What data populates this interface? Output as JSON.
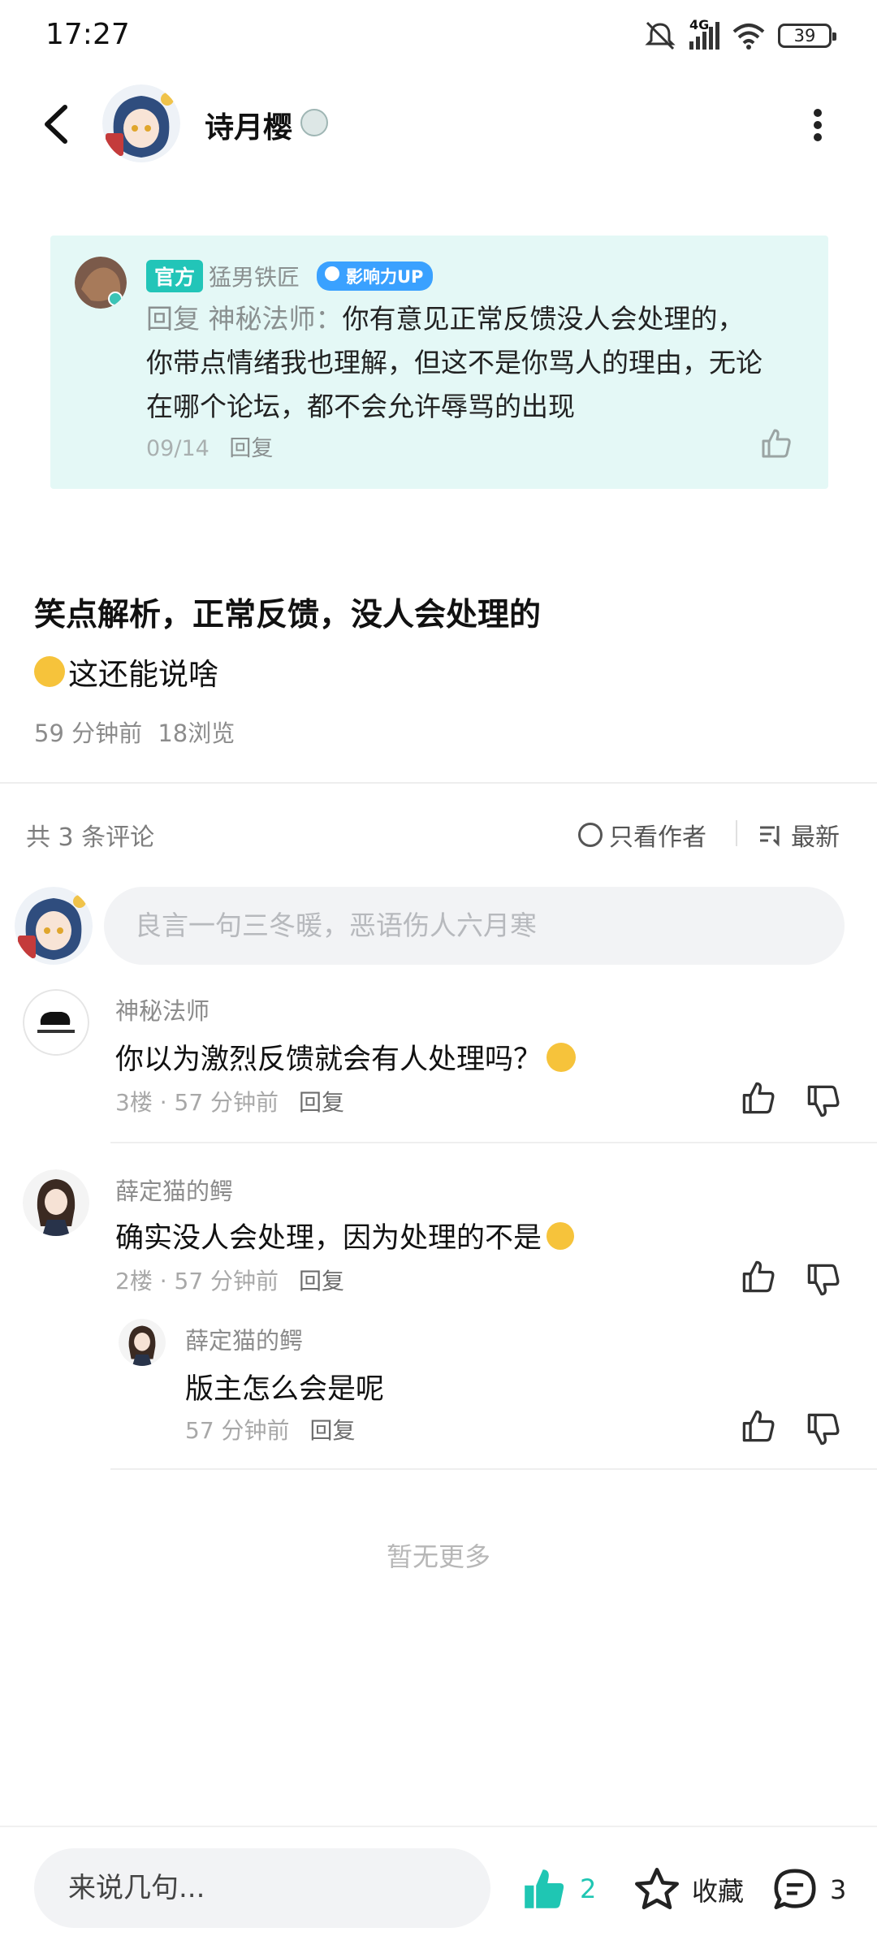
{
  "status_bar": {
    "time": "17:27",
    "network": "4G",
    "battery": "39"
  },
  "header": {
    "author_name": "诗月樱"
  },
  "quote_card": {
    "tag": "官方",
    "user_name": "猛男铁匠",
    "badge": "影响力UP",
    "reply_prefix": "回复 神秘法师：",
    "text_line1": "你有意见正常反馈没人会处理的，",
    "text_line2": "你带点情绪我也理解，但这不是你骂人的理由，无论",
    "text_line3": "在哪个论坛，都不会允许辱骂的出现",
    "date": "09/14",
    "reply_label": "回复"
  },
  "post": {
    "title": "笑点解析，正常反馈，没人会处理的",
    "body": "这还能说啥",
    "time": "59 分钟前",
    "views": "18浏览"
  },
  "comments_bar": {
    "count": "共 3 条评论",
    "author_only": "只看作者",
    "sort": "最新"
  },
  "comment_input": {
    "placeholder": "良言一句三冬暖，恶语伤人六月寒"
  },
  "comments": [
    {
      "name": "神秘法师",
      "text": "你以为激烈反馈就会有人处理吗？",
      "floor": "3楼",
      "time": "57 分钟前",
      "reply_label": "回复"
    },
    {
      "name": "薛定猫的鳄",
      "text": "确实没人会处理，因为处理的不是",
      "floor": "2楼",
      "time": "57 分钟前",
      "reply_label": "回复",
      "replies": [
        {
          "name": "薛定猫的鳄",
          "text": "版主怎么会是呢",
          "time": "57 分钟前",
          "reply_label": "回复"
        }
      ]
    }
  ],
  "no_more": "暂无更多",
  "bottom_bar": {
    "input_placeholder": "来说几句...",
    "like_count": "2",
    "favorite_label": "收藏",
    "comment_count": "3"
  },
  "colors": {
    "accent": "#1fc6b3",
    "quote_bg": "#e4f8f6",
    "official_tag": "#22c5b8",
    "influence_badge": "#3aa1ff"
  }
}
